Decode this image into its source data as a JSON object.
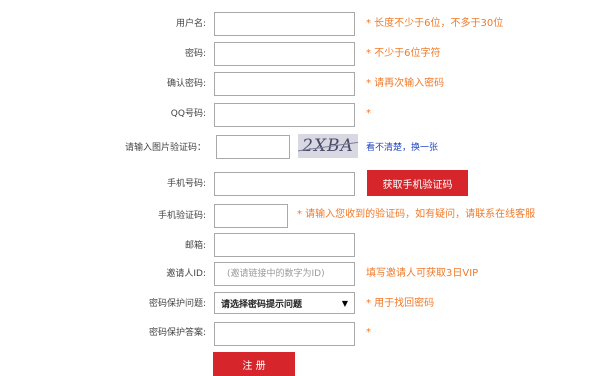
{
  "form": {
    "username": {
      "label": "用户名:",
      "hint": "* 长度不少于6位，不多于30位"
    },
    "password": {
      "label": "密码:",
      "hint": "* 不少于6位字符"
    },
    "confirm_password": {
      "label": "确认密码:",
      "hint": "* 请再次输入密码"
    },
    "qq": {
      "label": "QQ号码:",
      "hint": "*"
    },
    "captcha": {
      "label": "请输入图片验证码：",
      "image_text": "2XBA",
      "refresh_link": "看不清楚，换一张"
    },
    "phone": {
      "label": "手机号码:",
      "button": "获取手机验证码"
    },
    "sms_code": {
      "label": "手机验证码:",
      "hint": "* 请输入您收到的验证码，如有疑问，请联系在线客服"
    },
    "email": {
      "label": "邮箱:"
    },
    "inviter_id": {
      "label": "邀请人ID:",
      "placeholder": "(邀请链接中的数字为ID)",
      "hint": "填写邀请人可获取3日VIP"
    },
    "security_question": {
      "label": "密码保护问题:",
      "selected": "请选择密码提示问题",
      "hint": "* 用于找回密码"
    },
    "security_answer": {
      "label": "密码保护答案:",
      "hint": "*"
    },
    "submit": {
      "label": "注 册"
    }
  }
}
